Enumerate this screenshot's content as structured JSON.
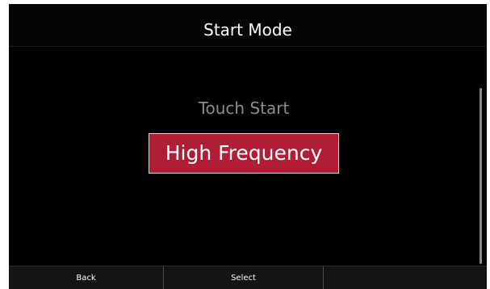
{
  "header": {
    "title": "Start Mode"
  },
  "options": [
    {
      "label": "Touch Start",
      "selected": false
    },
    {
      "label": "High Frequency",
      "selected": true
    }
  ],
  "softkeys": {
    "left": "Back",
    "middle": "Select",
    "right": ""
  },
  "colors": {
    "background": "#000000",
    "selected_fill": "#b01e35",
    "inactive_text": "#8c8c8c",
    "softkey_bar": "#141414"
  }
}
